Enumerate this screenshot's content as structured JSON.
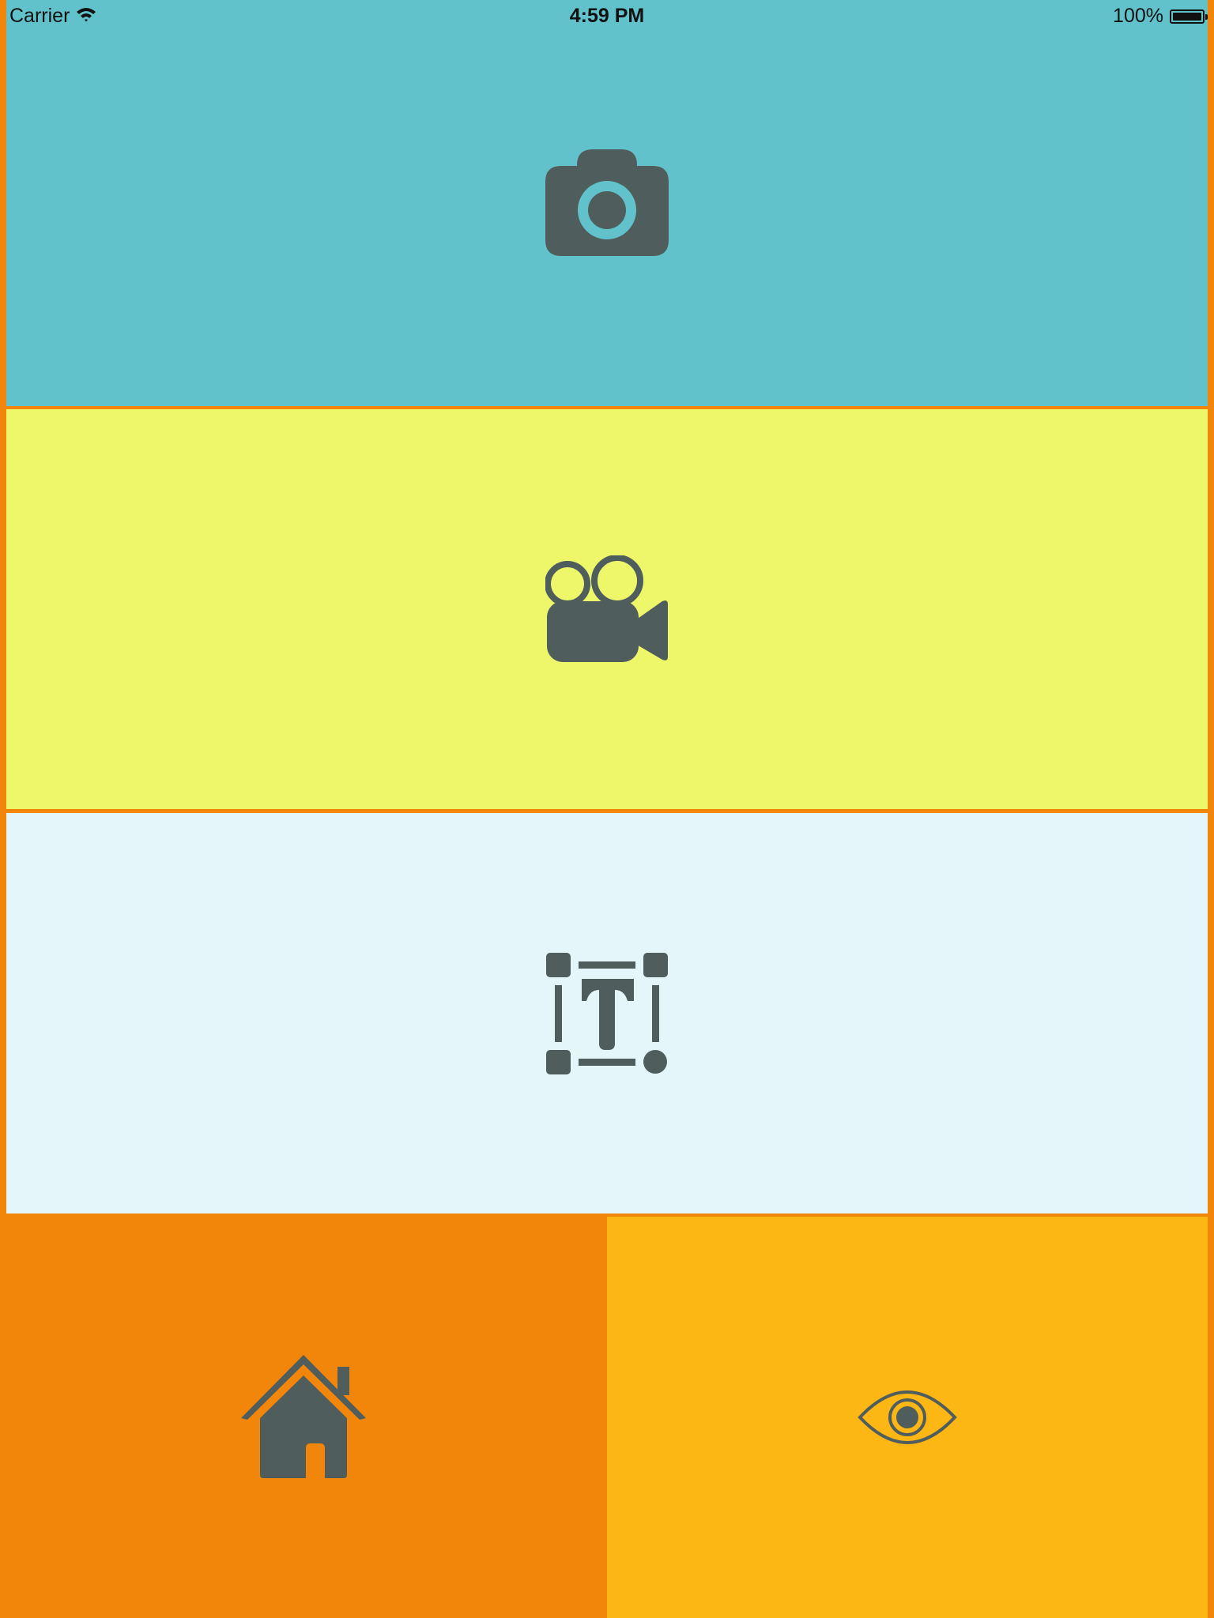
{
  "status_bar": {
    "carrier": "Carrier",
    "time": "4:59 PM",
    "battery": "100%",
    "wifi_icon": "wifi-icon",
    "battery_icon": "battery-icon"
  },
  "colors": {
    "border": "#f1860a",
    "photo_panel": "#62c2cb",
    "video_panel": "#eef76a",
    "text_panel": "#e4f6f9",
    "home_panel": "#f1860a",
    "view_panel": "#fdb714",
    "icon": "#4f5d5d"
  },
  "panels": [
    {
      "name": "photo-panel",
      "icon": "camera-icon"
    },
    {
      "name": "video-panel",
      "icon": "video-camera-icon"
    },
    {
      "name": "text-panel",
      "icon": "text-box-icon"
    },
    {
      "name": "home-panel",
      "icon": "home-icon"
    },
    {
      "name": "view-panel",
      "icon": "eye-icon"
    }
  ]
}
